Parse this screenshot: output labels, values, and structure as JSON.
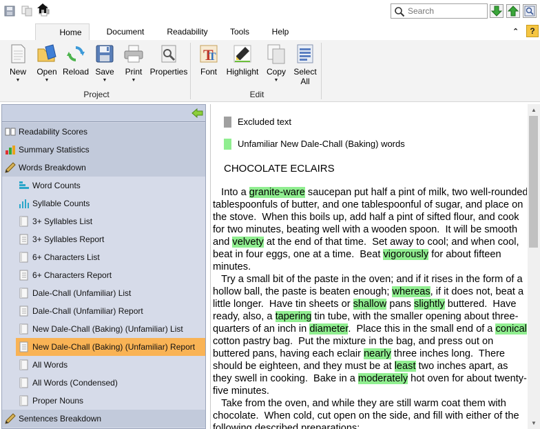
{
  "quick_access": {
    "icons": [
      "save-icon",
      "copy-icon",
      "print-icon"
    ]
  },
  "search": {
    "placeholder": "Search"
  },
  "tabs": [
    {
      "label": "Home",
      "active": true
    },
    {
      "label": "Document"
    },
    {
      "label": "Readability"
    },
    {
      "label": "Tools"
    },
    {
      "label": "Help"
    }
  ],
  "ribbon": {
    "project_group": {
      "label": "Project",
      "buttons": [
        {
          "label": "New",
          "has_dropdown": true
        },
        {
          "label": "Open",
          "has_dropdown": true
        },
        {
          "label": "Reload"
        },
        {
          "label": "Save",
          "has_dropdown": true
        },
        {
          "label": "Print",
          "has_dropdown": true
        },
        {
          "label": "Properties"
        }
      ]
    },
    "edit_group": {
      "label": "Edit",
      "buttons": [
        {
          "label": "Font"
        },
        {
          "label": "Highlight"
        },
        {
          "label": "Copy",
          "has_dropdown": true
        },
        {
          "label_line1": "Select",
          "label_line2": "All"
        }
      ]
    }
  },
  "sidebar": {
    "items": [
      {
        "label": "Readability Scores",
        "icon": "book-icon",
        "level": 0
      },
      {
        "label": "Summary Statistics",
        "icon": "stats-icon",
        "level": 0
      },
      {
        "label": "Words Breakdown",
        "icon": "pencil-icon",
        "level": 0
      },
      {
        "label": "Word Counts",
        "icon": "bar-chart-horizontal-icon",
        "level": 1
      },
      {
        "label": "Syllable Counts",
        "icon": "bar-chart-icon",
        "level": 1
      },
      {
        "label": "3+ Syllables List",
        "icon": "list-icon",
        "level": 1
      },
      {
        "label": "3+ Syllables Report",
        "icon": "report-icon",
        "level": 1
      },
      {
        "label": "6+ Characters List",
        "icon": "list-icon",
        "level": 1
      },
      {
        "label": "6+ Characters Report",
        "icon": "report-icon",
        "level": 1
      },
      {
        "label": "Dale-Chall (Unfamiliar) List",
        "icon": "list-icon",
        "level": 1
      },
      {
        "label": "Dale-Chall (Unfamiliar) Report",
        "icon": "report-icon",
        "level": 1
      },
      {
        "label": "New Dale-Chall (Baking) (Unfamiliar) List",
        "icon": "list-icon",
        "level": 1
      },
      {
        "label": "New Dale-Chall (Baking) (Unfamiliar) Report",
        "icon": "report-icon",
        "level": 1,
        "selected": true
      },
      {
        "label": "All Words",
        "icon": "list-icon",
        "level": 1
      },
      {
        "label": "All Words (Condensed)",
        "icon": "list-icon",
        "level": 1
      },
      {
        "label": "Proper Nouns",
        "icon": "list-icon",
        "level": 1
      },
      {
        "label": "Sentences Breakdown",
        "icon": "pencil-icon",
        "level": 0
      }
    ]
  },
  "document": {
    "legend": [
      {
        "label": "Excluded text",
        "color": "#a0a0a0"
      },
      {
        "label": "Unfamiliar New Dale-Chall (Baking) words",
        "color": "#90ee90"
      }
    ],
    "title": "CHOCOLATE ECLAIRS",
    "paragraphs": [
      [
        {
          "t": "   Into a "
        },
        {
          "t": "granite-ware",
          "hl": true
        },
        {
          "t": " saucepan put half a pint of milk, two well-rounded tablespoonfuls of butter, and one tablespoonful of sugar, and place on the stove.  When this boils up, add half a pint of sifted flour, and cook for two minutes, beating well with a wooden spoon.  It will be smooth and "
        },
        {
          "t": "velvety",
          "hl": true
        },
        {
          "t": " at the end of that time.  Set away to cool; and when cool, beat in four eggs, one at a time.  Beat "
        },
        {
          "t": "vigorously",
          "hl": true
        },
        {
          "t": " for about fifteen minutes."
        }
      ],
      [
        {
          "t": "   Try a small bit of the paste in the oven; and if it rises in the form of a hollow ball, the paste is beaten enough; "
        },
        {
          "t": "whereas",
          "hl": true
        },
        {
          "t": ", if it does not, beat a little longer.  Have tin sheets or "
        },
        {
          "t": "shallow",
          "hl": true
        },
        {
          "t": " pans "
        },
        {
          "t": "slightly",
          "hl": true
        },
        {
          "t": " buttered.  Have ready, also, a "
        },
        {
          "t": "tapering",
          "hl": true
        },
        {
          "t": " tin tube, with the smaller opening about three-quarters of an inch in "
        },
        {
          "t": "diameter",
          "hl": true
        },
        {
          "t": ".  Place this in the small end of a "
        },
        {
          "t": "conical",
          "hl": true
        },
        {
          "t": " cotton pastry bag.  Put the mixture in the bag, and press out on buttered pans, having each eclair "
        },
        {
          "t": "nearly",
          "hl": true
        },
        {
          "t": " three inches long.  There should be eighteen, and they must be at "
        },
        {
          "t": "least",
          "hl": true
        },
        {
          "t": " two inches apart, as they swell in cooking.  Bake in a "
        },
        {
          "t": "moderately",
          "hl": true
        },
        {
          "t": " hot oven for about twenty-five minutes."
        }
      ],
      [
        {
          "t": "   Take from the oven, and while they are still warm coat them with chocolate.  When cold, cut open on the side, and fill with either of the following described preparations:"
        }
      ]
    ]
  }
}
